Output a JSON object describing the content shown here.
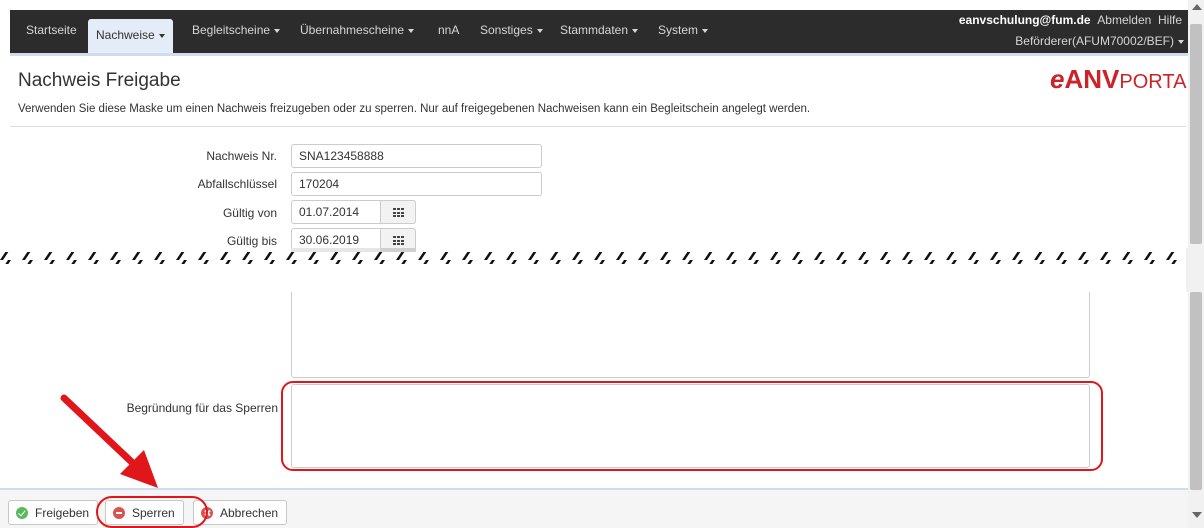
{
  "nav": {
    "items": [
      {
        "label": "Startseite"
      },
      {
        "label": "Nachweise"
      },
      {
        "label": "Begleitscheine"
      },
      {
        "label": "Übernahmescheine"
      },
      {
        "label": "nnA"
      },
      {
        "label": "Sonstiges"
      },
      {
        "label": "Stammdaten"
      },
      {
        "label": "System"
      }
    ],
    "user_email": "eanvschulung@fum.de",
    "logout_label": "Abmelden",
    "help_label": "Hilfe",
    "role": "Beförderer(AFUM70002/BEF)"
  },
  "header": {
    "title": "Nachweis Freigabe",
    "logo_e": "e",
    "logo_anv": "ANV",
    "logo_portal": "PORTAL",
    "intro": "Verwenden Sie diese Maske um einen Nachweis freizugeben oder zu sperren. Nur auf freigegebenen Nachweisen kann ein Begleitschein angelegt werden."
  },
  "form": {
    "nachweis_nr_label": "Nachweis Nr.",
    "nachweis_nr_value": "SNA123458888",
    "abfallschluessel_label": "Abfallschlüssel",
    "abfallschluessel_value": "170204",
    "gueltig_von_label": "Gültig von",
    "gueltig_von_value": "01.07.2014",
    "gueltig_bis_label": "Gültig bis",
    "gueltig_bis_value": "30.06.2019",
    "sperren_reason_label": "Begründung für das Sperren"
  },
  "toolbar": {
    "freigeben_label": "Freigeben",
    "sperren_label": "Sperren",
    "abbrechen_label": "Abbrechen"
  },
  "colors": {
    "navbar": "#2c2c2c",
    "brand_red": "#cc2229",
    "annotation_red": "#e0161b",
    "success": "#5cb85c",
    "danger": "#d9534f"
  }
}
